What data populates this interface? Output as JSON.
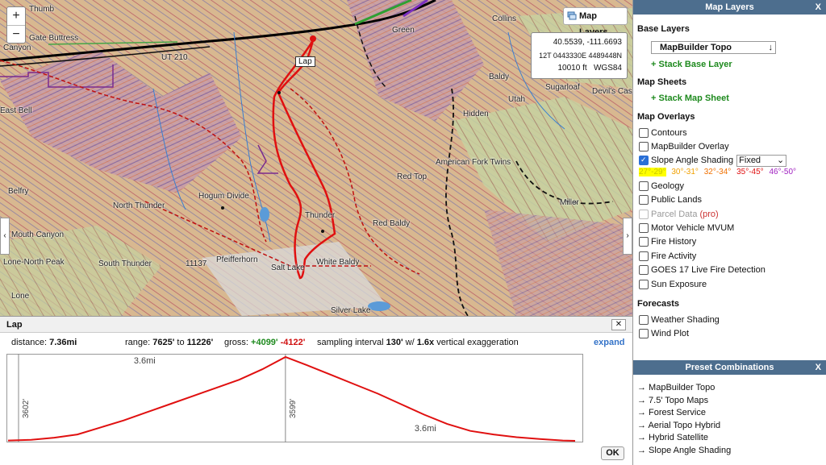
{
  "map": {
    "zoom_in": "+",
    "zoom_out": "−",
    "layers_button": "Map Layers",
    "coords": {
      "latlon": "40.5539, -111.6693",
      "utm": "12T 0443330E 4489448N",
      "elev": "10010 ft",
      "datum": "WGS84"
    },
    "left_arrow": "‹",
    "right_arrow": "›",
    "lap_label": "Lap",
    "place_labels": [
      "Thumb",
      "Gate Buttress",
      "Canyon",
      "UT 210",
      "Green",
      "Collins",
      "Baldy",
      "Sugarloaf",
      "Devil's Cast",
      "East Bell",
      "Hidden",
      "American Fork Twins",
      "Red Top",
      "Hogum Divide",
      "Belfry",
      "North Thunder",
      "Thunder",
      "Red Baldy",
      "Miller",
      "Mouth Canyon",
      "Lone-North Peak",
      "South Thunder",
      "Pfeifferhorn",
      "11137",
      "White Baldy",
      "Salt Lake",
      "Lone",
      "Silver Lake",
      "Utah"
    ]
  },
  "panel": {
    "title": "Map Layers",
    "close": "X",
    "base_layers_title": "Base Layers",
    "base_layer_value": "MapBuilder Topo",
    "stack_base": "+ Stack Base Layer",
    "map_sheets_title": "Map Sheets",
    "stack_sheet": "+ Stack Map Sheet",
    "overlays_title": "Map Overlays",
    "overlays": [
      {
        "label": "Contours",
        "checked": false
      },
      {
        "label": "MapBuilder Overlay",
        "checked": false
      },
      {
        "label": "Slope Angle Shading",
        "checked": true
      },
      {
        "label": "Geology",
        "checked": false
      },
      {
        "label": "Public Lands",
        "checked": false
      },
      {
        "label": "Parcel Data",
        "checked": false
      },
      {
        "label": "Motor Vehicle MVUM",
        "checked": false
      },
      {
        "label": "Fire History",
        "checked": false
      },
      {
        "label": "Fire Activity",
        "checked": false
      },
      {
        "label": "GOES 17 Live Fire Detection",
        "checked": false
      },
      {
        "label": "Sun Exposure",
        "checked": false
      }
    ],
    "slope_mode": "Fixed",
    "pro_tag": "(pro)",
    "slope_legend": [
      {
        "label": "27°-29°",
        "color": "#d4d400"
      },
      {
        "label": "30°-31°",
        "color": "#f0a000"
      },
      {
        "label": "32°-34°",
        "color": "#f07000"
      },
      {
        "label": "35°-45°",
        "color": "#e01010"
      },
      {
        "label": "46°-50°",
        "color": "#a020c0"
      }
    ],
    "forecasts_title": "Forecasts",
    "forecasts": [
      {
        "label": "Weather Shading",
        "checked": false
      },
      {
        "label": "Wind Plot",
        "checked": false
      }
    ]
  },
  "preset": {
    "title": "Preset Combinations",
    "close": "X",
    "items": [
      "→ MapBuilder Topo",
      "→ 7.5' Topo Maps",
      "→ Forest Service",
      "→ Aerial Topo Hybrid",
      "→ Hybrid Satellite",
      "→ Slope Angle Shading"
    ]
  },
  "profile": {
    "title": "Lap",
    "close": "✕",
    "distance_label": "distance:",
    "distance_value": "7.36mi",
    "range_label": "range:",
    "range_low": "7625'",
    "range_to": "to",
    "range_high": "11226'",
    "gross_label": "gross:",
    "gain": "+4099'",
    "loss": "-4122'",
    "sampling_label": "sampling interval",
    "sampling_value": "130'",
    "w_label": "w/",
    "exaggeration": "1.6x",
    "exaggeration_label": "vertical exaggeration",
    "expand": "expand",
    "ok": "OK",
    "marker_top": "3.6mi",
    "marker_bottom": "3.6mi",
    "left_gain": "3602'",
    "right_loss": "3599'"
  },
  "chart_data": {
    "type": "line",
    "x": [
      0,
      0.3,
      0.6,
      0.9,
      1.2,
      1.5,
      1.8,
      2.1,
      2.4,
      2.7,
      3.0,
      3.3,
      3.6,
      3.9,
      4.2,
      4.5,
      4.8,
      5.1,
      5.4,
      5.7,
      6.0,
      6.3,
      6.6,
      6.9,
      7.2,
      7.36
    ],
    "y": [
      7640,
      7670,
      7760,
      7900,
      8200,
      8500,
      8850,
      9200,
      9550,
      9900,
      10250,
      10700,
      11226,
      10850,
      10450,
      10050,
      9650,
      9200,
      8750,
      8350,
      8050,
      7900,
      7780,
      7700,
      7640,
      7625
    ],
    "ylim": [
      7625,
      11226
    ],
    "xlim": [
      0,
      7.36
    ]
  }
}
